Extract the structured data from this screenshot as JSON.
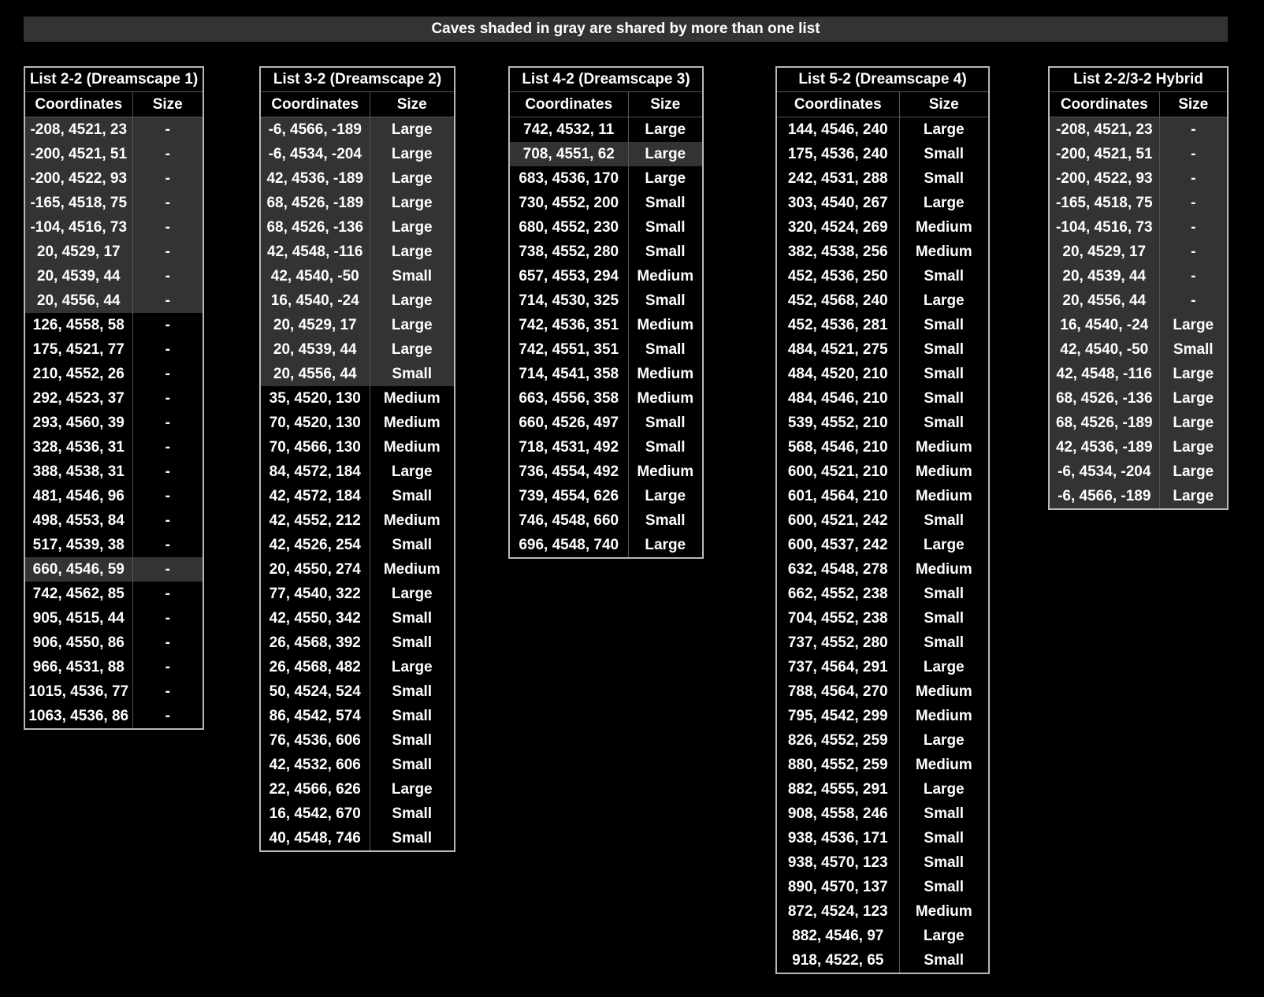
{
  "banner": "Caves shaded in gray are shared by more than one list",
  "colors": {
    "background": "#000000",
    "shared_shade": "#333333",
    "text": "#ffffff",
    "border": "#b8b8b8"
  },
  "lists": [
    {
      "title": "List 2-2 (Dreamscape 1)",
      "col_coordinates": "Coordinates",
      "col_size": "Size",
      "rows": [
        {
          "coords": "-208, 4521, 23",
          "size": "-",
          "shared": true
        },
        {
          "coords": "-200, 4521, 51",
          "size": "-",
          "shared": true
        },
        {
          "coords": "-200, 4522, 93",
          "size": "-",
          "shared": true
        },
        {
          "coords": "-165, 4518, 75",
          "size": "-",
          "shared": true
        },
        {
          "coords": "-104, 4516, 73",
          "size": "-",
          "shared": true
        },
        {
          "coords": "20, 4529, 17",
          "size": "-",
          "shared": true
        },
        {
          "coords": "20, 4539, 44",
          "size": "-",
          "shared": true
        },
        {
          "coords": "20, 4556, 44",
          "size": "-",
          "shared": true
        },
        {
          "coords": "126, 4558, 58",
          "size": "-",
          "shared": false
        },
        {
          "coords": "175, 4521, 77",
          "size": "-",
          "shared": false
        },
        {
          "coords": "210, 4552, 26",
          "size": "-",
          "shared": false
        },
        {
          "coords": "292, 4523, 37",
          "size": "-",
          "shared": false
        },
        {
          "coords": "293, 4560, 39",
          "size": "-",
          "shared": false
        },
        {
          "coords": "328, 4536, 31",
          "size": "-",
          "shared": false
        },
        {
          "coords": "388, 4538, 31",
          "size": "-",
          "shared": false
        },
        {
          "coords": "481, 4546, 96",
          "size": "-",
          "shared": false
        },
        {
          "coords": "498, 4553, 84",
          "size": "-",
          "shared": false
        },
        {
          "coords": "517, 4539, 38",
          "size": "-",
          "shared": false
        },
        {
          "coords": "660, 4546, 59",
          "size": "-",
          "shared": true
        },
        {
          "coords": "742, 4562, 85",
          "size": "-",
          "shared": false
        },
        {
          "coords": "905, 4515, 44",
          "size": "-",
          "shared": false
        },
        {
          "coords": "906, 4550, 86",
          "size": "-",
          "shared": false
        },
        {
          "coords": "966, 4531, 88",
          "size": "-",
          "shared": false
        },
        {
          "coords": "1015, 4536, 77",
          "size": "-",
          "shared": false
        },
        {
          "coords": "1063, 4536, 86",
          "size": "-",
          "shared": false
        }
      ]
    },
    {
      "title": "List 3-2 (Dreamscape 2)",
      "col_coordinates": "Coordinates",
      "col_size": "Size",
      "rows": [
        {
          "coords": "-6, 4566, -189",
          "size": "Large",
          "shared": true
        },
        {
          "coords": "-6, 4534, -204",
          "size": "Large",
          "shared": true
        },
        {
          "coords": "42, 4536, -189",
          "size": "Large",
          "shared": true
        },
        {
          "coords": "68, 4526, -189",
          "size": "Large",
          "shared": true
        },
        {
          "coords": "68, 4526, -136",
          "size": "Large",
          "shared": true
        },
        {
          "coords": "42, 4548, -116",
          "size": "Large",
          "shared": true
        },
        {
          "coords": "42, 4540, -50",
          "size": "Small",
          "shared": true
        },
        {
          "coords": "16, 4540, -24",
          "size": "Large",
          "shared": true
        },
        {
          "coords": "20, 4529, 17",
          "size": "Large",
          "shared": true
        },
        {
          "coords": "20, 4539, 44",
          "size": "Large",
          "shared": true
        },
        {
          "coords": "20, 4556, 44",
          "size": "Small",
          "shared": true
        },
        {
          "coords": "35, 4520, 130",
          "size": "Medium",
          "shared": false
        },
        {
          "coords": "70, 4520, 130",
          "size": "Medium",
          "shared": false
        },
        {
          "coords": "70, 4566, 130",
          "size": "Medium",
          "shared": false
        },
        {
          "coords": "84, 4572, 184",
          "size": "Large",
          "shared": false
        },
        {
          "coords": "42, 4572, 184",
          "size": "Small",
          "shared": false
        },
        {
          "coords": "42, 4552, 212",
          "size": "Medium",
          "shared": false
        },
        {
          "coords": "42, 4526, 254",
          "size": "Small",
          "shared": false
        },
        {
          "coords": "20, 4550, 274",
          "size": "Medium",
          "shared": false
        },
        {
          "coords": "77, 4540, 322",
          "size": "Large",
          "shared": false
        },
        {
          "coords": "42, 4550, 342",
          "size": "Small",
          "shared": false
        },
        {
          "coords": "26, 4568, 392",
          "size": "Small",
          "shared": false
        },
        {
          "coords": "26, 4568, 482",
          "size": "Large",
          "shared": false
        },
        {
          "coords": "50, 4524, 524",
          "size": "Small",
          "shared": false
        },
        {
          "coords": "86, 4542, 574",
          "size": "Small",
          "shared": false
        },
        {
          "coords": "76, 4536, 606",
          "size": "Small",
          "shared": false
        },
        {
          "coords": "42, 4532, 606",
          "size": "Small",
          "shared": false
        },
        {
          "coords": "22, 4566, 626",
          "size": "Large",
          "shared": false
        },
        {
          "coords": "16, 4542, 670",
          "size": "Small",
          "shared": false
        },
        {
          "coords": "40, 4548, 746",
          "size": "Small",
          "shared": false
        }
      ]
    },
    {
      "title": "List 4-2 (Dreamscape 3)",
      "col_coordinates": "Coordinates",
      "col_size": "Size",
      "rows": [
        {
          "coords": "742, 4532, 11",
          "size": "Large",
          "shared": false
        },
        {
          "coords": "708, 4551, 62",
          "size": "Large",
          "shared": true
        },
        {
          "coords": "683, 4536, 170",
          "size": "Large",
          "shared": false
        },
        {
          "coords": "730, 4552, 200",
          "size": "Small",
          "shared": false
        },
        {
          "coords": "680, 4552, 230",
          "size": "Small",
          "shared": false
        },
        {
          "coords": "738, 4552, 280",
          "size": "Small",
          "shared": false
        },
        {
          "coords": "657, 4553, 294",
          "size": "Medium",
          "shared": false
        },
        {
          "coords": "714, 4530, 325",
          "size": "Small",
          "shared": false
        },
        {
          "coords": "742, 4536, 351",
          "size": "Medium",
          "shared": false
        },
        {
          "coords": "742, 4551, 351",
          "size": "Small",
          "shared": false
        },
        {
          "coords": "714, 4541, 358",
          "size": "Medium",
          "shared": false
        },
        {
          "coords": "663, 4556, 358",
          "size": "Medium",
          "shared": false
        },
        {
          "coords": "660, 4526, 497",
          "size": "Small",
          "shared": false
        },
        {
          "coords": "718, 4531, 492",
          "size": "Small",
          "shared": false
        },
        {
          "coords": "736, 4554, 492",
          "size": "Medium",
          "shared": false
        },
        {
          "coords": "739, 4554, 626",
          "size": "Large",
          "shared": false
        },
        {
          "coords": "746, 4548, 660",
          "size": "Small",
          "shared": false
        },
        {
          "coords": "696, 4548, 740",
          "size": "Large",
          "shared": false
        }
      ]
    },
    {
      "title": "List 5-2 (Dreamscape 4)",
      "col_coordinates": "Coordinates",
      "col_size": "Size",
      "rows": [
        {
          "coords": "144, 4546, 240",
          "size": "Large",
          "shared": false
        },
        {
          "coords": "175, 4536, 240",
          "size": "Small",
          "shared": false
        },
        {
          "coords": "242, 4531, 288",
          "size": "Small",
          "shared": false
        },
        {
          "coords": "303, 4540, 267",
          "size": "Large",
          "shared": false
        },
        {
          "coords": "320, 4524, 269",
          "size": "Medium",
          "shared": false
        },
        {
          "coords": "382, 4538, 256",
          "size": "Medium",
          "shared": false
        },
        {
          "coords": "452, 4536, 250",
          "size": "Small",
          "shared": false
        },
        {
          "coords": "452, 4568, 240",
          "size": "Large",
          "shared": false
        },
        {
          "coords": "452, 4536, 281",
          "size": "Small",
          "shared": false
        },
        {
          "coords": "484, 4521, 275",
          "size": "Small",
          "shared": false
        },
        {
          "coords": "484, 4520, 210",
          "size": "Small",
          "shared": false
        },
        {
          "coords": "484, 4546, 210",
          "size": "Small",
          "shared": false
        },
        {
          "coords": "539, 4552, 210",
          "size": "Small",
          "shared": false
        },
        {
          "coords": "568, 4546, 210",
          "size": "Medium",
          "shared": false
        },
        {
          "coords": "600, 4521, 210",
          "size": "Medium",
          "shared": false
        },
        {
          "coords": "601, 4564, 210",
          "size": "Medium",
          "shared": false
        },
        {
          "coords": "600, 4521, 242",
          "size": "Small",
          "shared": false
        },
        {
          "coords": "600, 4537, 242",
          "size": "Large",
          "shared": false
        },
        {
          "coords": "632, 4548, 278",
          "size": "Medium",
          "shared": false
        },
        {
          "coords": "662, 4552, 238",
          "size": "Small",
          "shared": false
        },
        {
          "coords": "704, 4552, 238",
          "size": "Small",
          "shared": false
        },
        {
          "coords": "737, 4552, 280",
          "size": "Small",
          "shared": false
        },
        {
          "coords": "737, 4564, 291",
          "size": "Large",
          "shared": false
        },
        {
          "coords": "788, 4564, 270",
          "size": "Medium",
          "shared": false
        },
        {
          "coords": "795, 4542, 299",
          "size": "Medium",
          "shared": false
        },
        {
          "coords": "826, 4552, 259",
          "size": "Large",
          "shared": false
        },
        {
          "coords": "880, 4552, 259",
          "size": "Medium",
          "shared": false
        },
        {
          "coords": "882, 4555, 291",
          "size": "Large",
          "shared": false
        },
        {
          "coords": "908, 4558, 246",
          "size": "Small",
          "shared": false
        },
        {
          "coords": "938, 4536, 171",
          "size": "Small",
          "shared": false
        },
        {
          "coords": "938, 4570, 123",
          "size": "Small",
          "shared": false
        },
        {
          "coords": "890, 4570, 137",
          "size": "Small",
          "shared": false
        },
        {
          "coords": "872, 4524, 123",
          "size": "Medium",
          "shared": false
        },
        {
          "coords": "882, 4546, 97",
          "size": "Large",
          "shared": false
        },
        {
          "coords": "918, 4522, 65",
          "size": "Small",
          "shared": false
        }
      ]
    },
    {
      "title": "List 2-2/3-2 Hybrid",
      "col_coordinates": "Coordinates",
      "col_size": "Size",
      "rows": [
        {
          "coords": "-208, 4521, 23",
          "size": "-",
          "shared": true
        },
        {
          "coords": "-200, 4521, 51",
          "size": "-",
          "shared": true
        },
        {
          "coords": "-200, 4522, 93",
          "size": "-",
          "shared": true
        },
        {
          "coords": "-165, 4518, 75",
          "size": "-",
          "shared": true
        },
        {
          "coords": "-104, 4516, 73",
          "size": "-",
          "shared": true
        },
        {
          "coords": "20, 4529, 17",
          "size": "-",
          "shared": true
        },
        {
          "coords": "20, 4539, 44",
          "size": "-",
          "shared": true
        },
        {
          "coords": "20, 4556, 44",
          "size": "-",
          "shared": true
        },
        {
          "coords": "16, 4540, -24",
          "size": "Large",
          "shared": true
        },
        {
          "coords": "42, 4540, -50",
          "size": "Small",
          "shared": true
        },
        {
          "coords": "42, 4548, -116",
          "size": "Large",
          "shared": true
        },
        {
          "coords": "68, 4526, -136",
          "size": "Large",
          "shared": true
        },
        {
          "coords": "68, 4526, -189",
          "size": "Large",
          "shared": true
        },
        {
          "coords": "42, 4536, -189",
          "size": "Large",
          "shared": true
        },
        {
          "coords": "-6, 4534, -204",
          "size": "Large",
          "shared": true
        },
        {
          "coords": "-6, 4566, -189",
          "size": "Large",
          "shared": true
        }
      ]
    }
  ]
}
